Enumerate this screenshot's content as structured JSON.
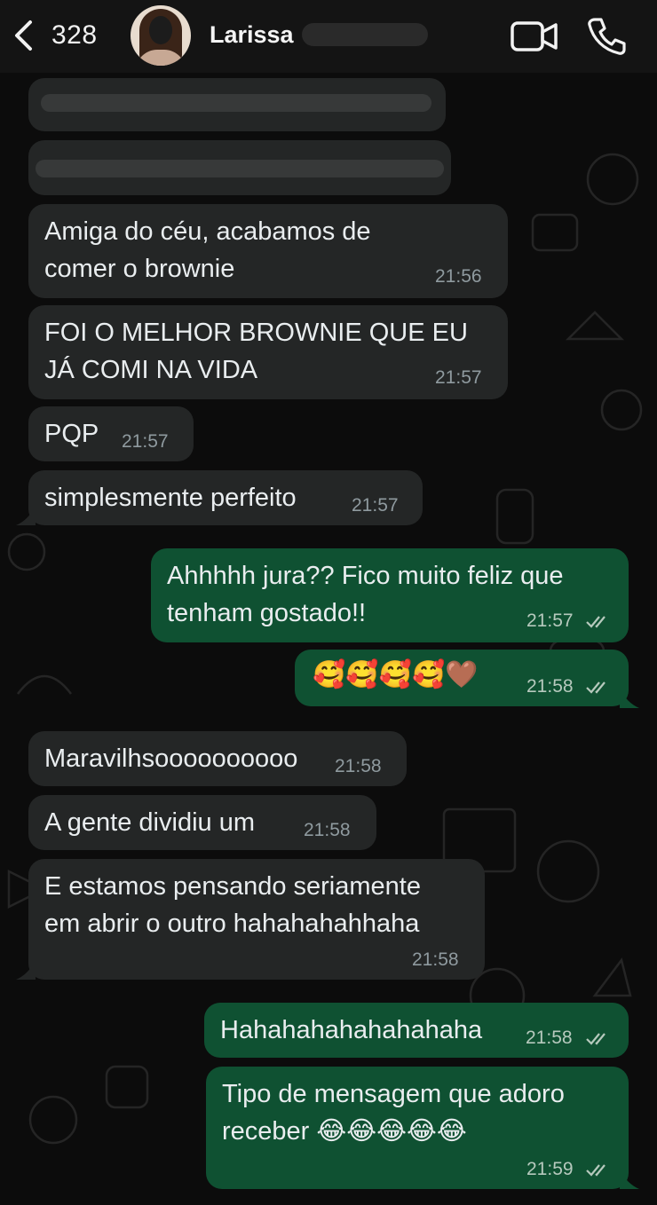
{
  "header": {
    "back_count": "328",
    "contact_name": "Larissa"
  },
  "messages": [
    {
      "text": "Amiga do céu, acabamos de\ncomer o brownie",
      "time": "21:56"
    },
    {
      "text": "FOI O MELHOR BROWNIE QUE EU\nJÁ COMI NA VIDA",
      "time": "21:57"
    },
    {
      "text": "PQP",
      "time": "21:57"
    },
    {
      "text": "simplesmente perfeito",
      "time": "21:57"
    },
    {
      "text": "Ahhhhh jura?? Fico muito feliz que\ntenham gostado!!",
      "time": "21:57"
    },
    {
      "text": "🥰🥰🥰🥰🤎",
      "time": "21:58"
    },
    {
      "text": "Maravilhsoooooooooo",
      "time": "21:58"
    },
    {
      "text": "A gente dividiu um",
      "time": "21:58"
    },
    {
      "text": "E estamos pensando seriamente\nem abrir o outro hahahahahhaha",
      "time": "21:58"
    },
    {
      "text": "Hahahahahahahahaha",
      "time": "21:58"
    },
    {
      "text": "Tipo de mensagem que adoro\nreceber 😂😂😂😂😂",
      "time": "21:59"
    }
  ],
  "colors": {
    "incoming_bubble": "#242626",
    "outgoing_bubble": "#0f5132",
    "header_bg": "#141414",
    "background": "#0c0c0c"
  },
  "icons": [
    "chevron-left-icon",
    "video-camera-icon",
    "phone-icon",
    "double-check-icon"
  ]
}
